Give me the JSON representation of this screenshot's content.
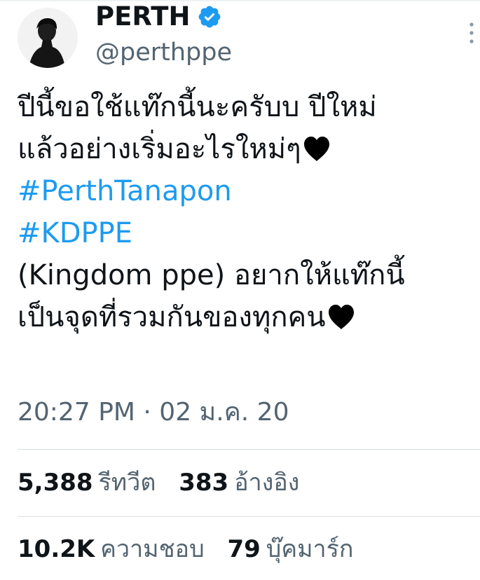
{
  "theme": {
    "text": "#0f1419",
    "secondary": "#536471",
    "link": "#1d9bf0",
    "verified": "#1d9bf0",
    "divider": "#d9dee2"
  },
  "author": {
    "display_name": "PERTH",
    "handle": "@perthppe",
    "verified_icon": "verified-badge-icon",
    "avatar_icon": "profile-photo"
  },
  "menu": {
    "icon": "more-vertical-icon"
  },
  "tweet": {
    "lines": [
      "ปีนี้ขอใช้แท๊กนี้นะครับบ ปีใหม่",
      "แล้วอย่างเริ่มอะไรใหม่ๆ",
      "#PerthTanapon",
      "#KDPPE",
      "(Kingdom ppe) อยากให้แท๊กนี้",
      "เป็นจุดที่รวมกันของทุกคน"
    ],
    "heart_icon": "black-heart-icon"
  },
  "timestamp": "20:27 PM · 02 ม.ค. 20",
  "stats": {
    "retweets": {
      "count": "5,388",
      "label": "รีทวีต"
    },
    "quotes": {
      "count": "383",
      "label": "อ้างอิง"
    },
    "likes": {
      "count": "10.2K",
      "label": "ความชอบ"
    },
    "bookmarks": {
      "count": "79",
      "label": "บุ๊คมาร์ก"
    }
  }
}
